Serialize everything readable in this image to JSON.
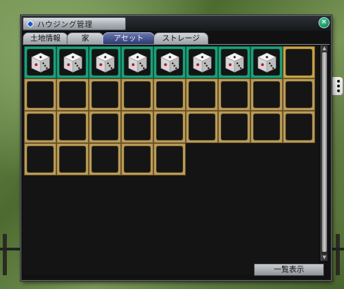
{
  "window": {
    "title": "ハウジング管理",
    "close_icon": "close-icon"
  },
  "tabs": [
    {
      "label": "土地情報",
      "active": false
    },
    {
      "label": "家",
      "active": false
    },
    {
      "label": "アセット",
      "active": true
    },
    {
      "label": "ストレージ",
      "active": false
    }
  ],
  "inventory": {
    "columns": 9,
    "slots": [
      "dice",
      "dice",
      "dice",
      "dice",
      "dice",
      "dice",
      "dice",
      "dice",
      "empty-selected",
      "empty",
      "empty",
      "empty",
      "empty",
      "empty",
      "empty",
      "empty",
      "empty",
      "empty",
      "empty",
      "empty",
      "empty",
      "empty",
      "empty",
      "empty",
      "empty",
      "empty",
      "empty",
      "empty",
      "empty",
      "empty",
      "empty",
      "empty"
    ],
    "item_icon": "dice-icon"
  },
  "footer": {
    "list_view_label": "一覧表示"
  },
  "colors": {
    "slot_frame": "#b89a5a",
    "slot_filled": "#1f9e79",
    "active_tab": "#2d3a73"
  }
}
